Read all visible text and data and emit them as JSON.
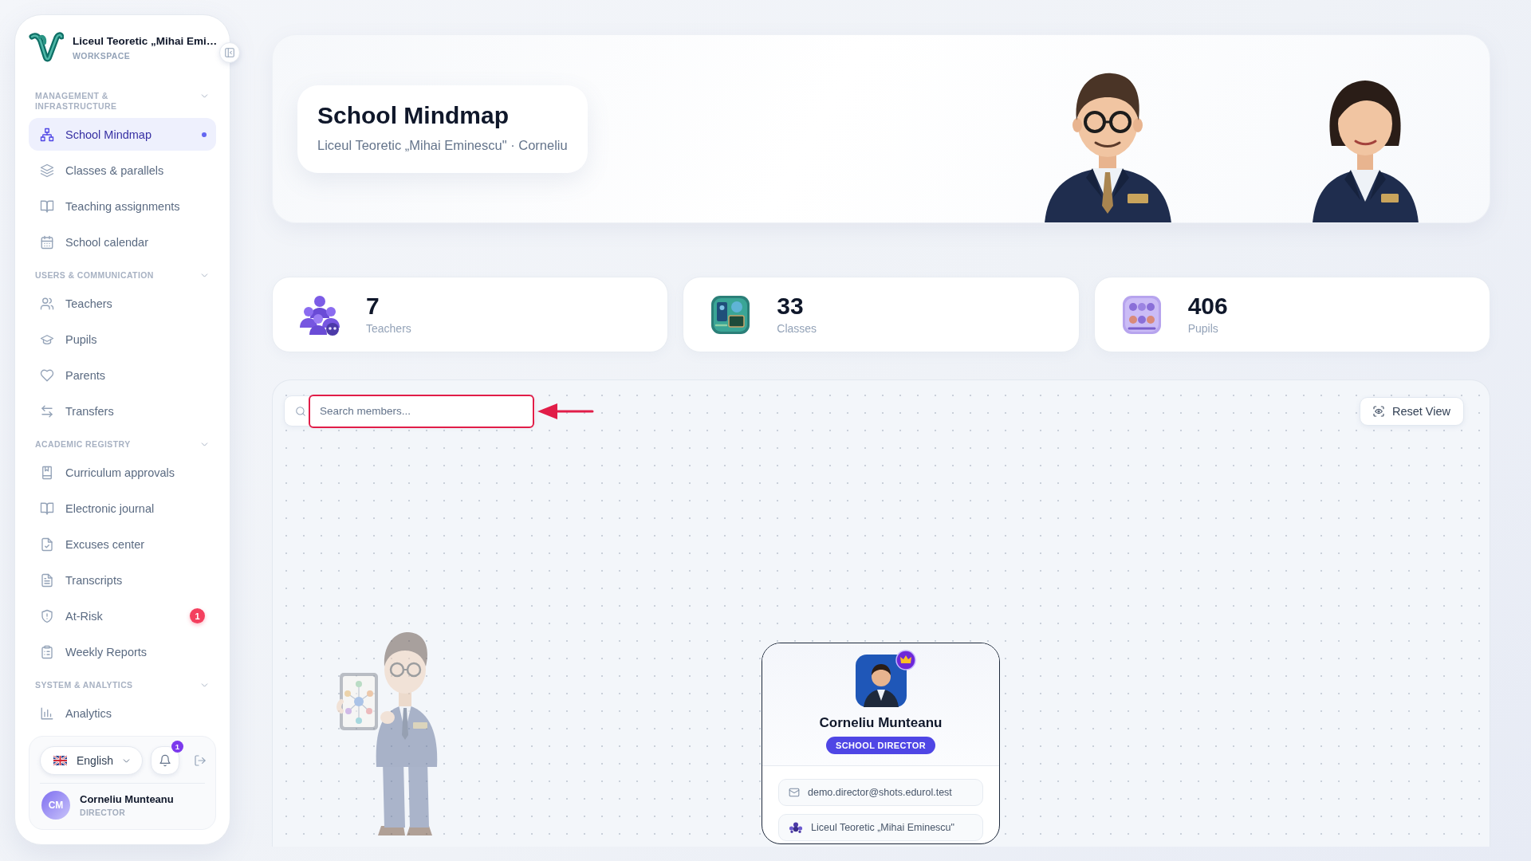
{
  "sidebar": {
    "workspace": {
      "name": "Liceul Teoretic „Mihai Emi…",
      "label": "WORKSPACE"
    },
    "sections": [
      {
        "title": "MANAGEMENT & INFRASTRUCTURE",
        "expanded": true,
        "items": [
          {
            "label": "School Mindmap",
            "selected": true
          },
          {
            "label": "Classes & parallels",
            "selected": false
          },
          {
            "label": "Teaching assignments",
            "selected": false
          },
          {
            "label": "School calendar",
            "selected": false
          }
        ]
      },
      {
        "title": "USERS & COMMUNICATION",
        "expanded": true,
        "items": [
          {
            "label": "Teachers",
            "selected": false
          },
          {
            "label": "Pupils",
            "selected": false
          },
          {
            "label": "Parents",
            "selected": false
          },
          {
            "label": "Transfers",
            "selected": false
          }
        ]
      },
      {
        "title": "ACADEMIC REGISTRY",
        "expanded": true,
        "items": [
          {
            "label": "Curriculum approvals",
            "selected": false
          },
          {
            "label": "Electronic journal",
            "selected": false
          },
          {
            "label": "Excuses center",
            "selected": false
          },
          {
            "label": "Transcripts",
            "selected": false
          },
          {
            "label": "At-Risk",
            "selected": false,
            "badge": "1"
          },
          {
            "label": "Weekly Reports",
            "selected": false
          }
        ]
      },
      {
        "title": "SYSTEM & ANALYTICS",
        "expanded": true,
        "items": [
          {
            "label": "Analytics",
            "selected": false
          }
        ]
      }
    ],
    "footer": {
      "language": "English",
      "notifications": "1",
      "user": {
        "initials": "CM",
        "name": "Corneliu Munteanu",
        "role": "DIRECTOR"
      }
    }
  },
  "header": {
    "title": "School Mindmap",
    "subtitle": "Liceul Teoretic „Mihai Eminescu\" · Corneliu"
  },
  "stats": [
    {
      "value": "7",
      "label": "Teachers"
    },
    {
      "value": "33",
      "label": "Classes"
    },
    {
      "value": "406",
      "label": "Pupils"
    }
  ],
  "mindmap": {
    "search": {
      "placeholder": "Search members..."
    },
    "reset_button": "Reset View",
    "director": {
      "name": "Corneliu Munteanu",
      "role": "SCHOOL DIRECTOR",
      "email": "demo.director@shots.edurol.test",
      "school": "Liceul Teoretic „Mihai Eminescu\""
    }
  }
}
